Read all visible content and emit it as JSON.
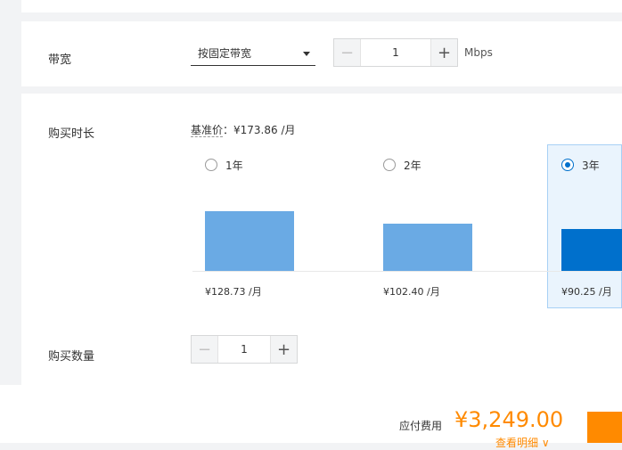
{
  "bandwidth": {
    "label": "带宽",
    "mode_value": "按固定带宽",
    "stepper": {
      "minus": "−",
      "value": "1",
      "plus": "+"
    },
    "unit": "Mbps"
  },
  "duration": {
    "label": "购买时长",
    "base_price_key": "基准价",
    "base_price_value": "：¥173.86 /月",
    "options": [
      {
        "label": "1年",
        "price": "¥128.73 /月",
        "monthly": 128.73,
        "selected": false
      },
      {
        "label": "2年",
        "price": "¥102.40 /月",
        "monthly": 102.4,
        "selected": false
      },
      {
        "label": "3年",
        "price": "¥90.25 /月",
        "monthly": 90.25,
        "selected": true
      }
    ]
  },
  "quantity": {
    "label": "购买数量",
    "stepper": {
      "minus": "−",
      "value": "1",
      "plus": "+"
    }
  },
  "footer": {
    "fee_label": "应付费用",
    "fee_amount": "¥3,249.00",
    "detail_link": "查看明细 ∨"
  },
  "colors": {
    "accent_orange": "#ff8a00",
    "selected_blue": "#0070cc",
    "bar_blue": "#6aaae4"
  }
}
